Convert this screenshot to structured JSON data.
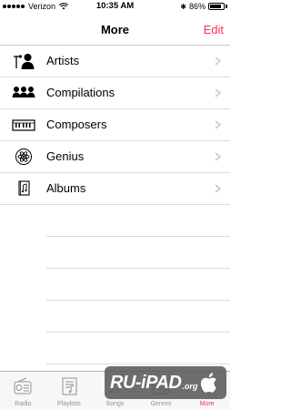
{
  "status_bar": {
    "carrier": "Verizon",
    "time": "10:35 AM",
    "bluetooth": "✱",
    "battery_percent": "86%",
    "battery_level": 0.86
  },
  "nav": {
    "title": "More",
    "edit_label": "Edit"
  },
  "list": {
    "items": [
      {
        "label": "Artists",
        "icon": "artist-icon"
      },
      {
        "label": "Compilations",
        "icon": "compilations-icon"
      },
      {
        "label": "Composers",
        "icon": "piano-keyboard-icon"
      },
      {
        "label": "Genius",
        "icon": "atom-icon"
      },
      {
        "label": "Albums",
        "icon": "album-icon"
      }
    ]
  },
  "tab_bar": {
    "tabs": [
      {
        "label": "Radio",
        "icon": "radio-icon"
      },
      {
        "label": "Playlists",
        "icon": "playlist-icon"
      },
      {
        "label": "Songs",
        "icon": "music-note-icon"
      },
      {
        "label": "Genres",
        "icon": "genres-icon"
      },
      {
        "label": "More",
        "icon": "more-icon"
      }
    ],
    "active_color": "#ff2d55",
    "inactive_color": "#929292"
  },
  "watermark": {
    "text": "RU-iPAD",
    "suffix": ".org"
  },
  "colors": {
    "accent": "#ff2d55"
  }
}
